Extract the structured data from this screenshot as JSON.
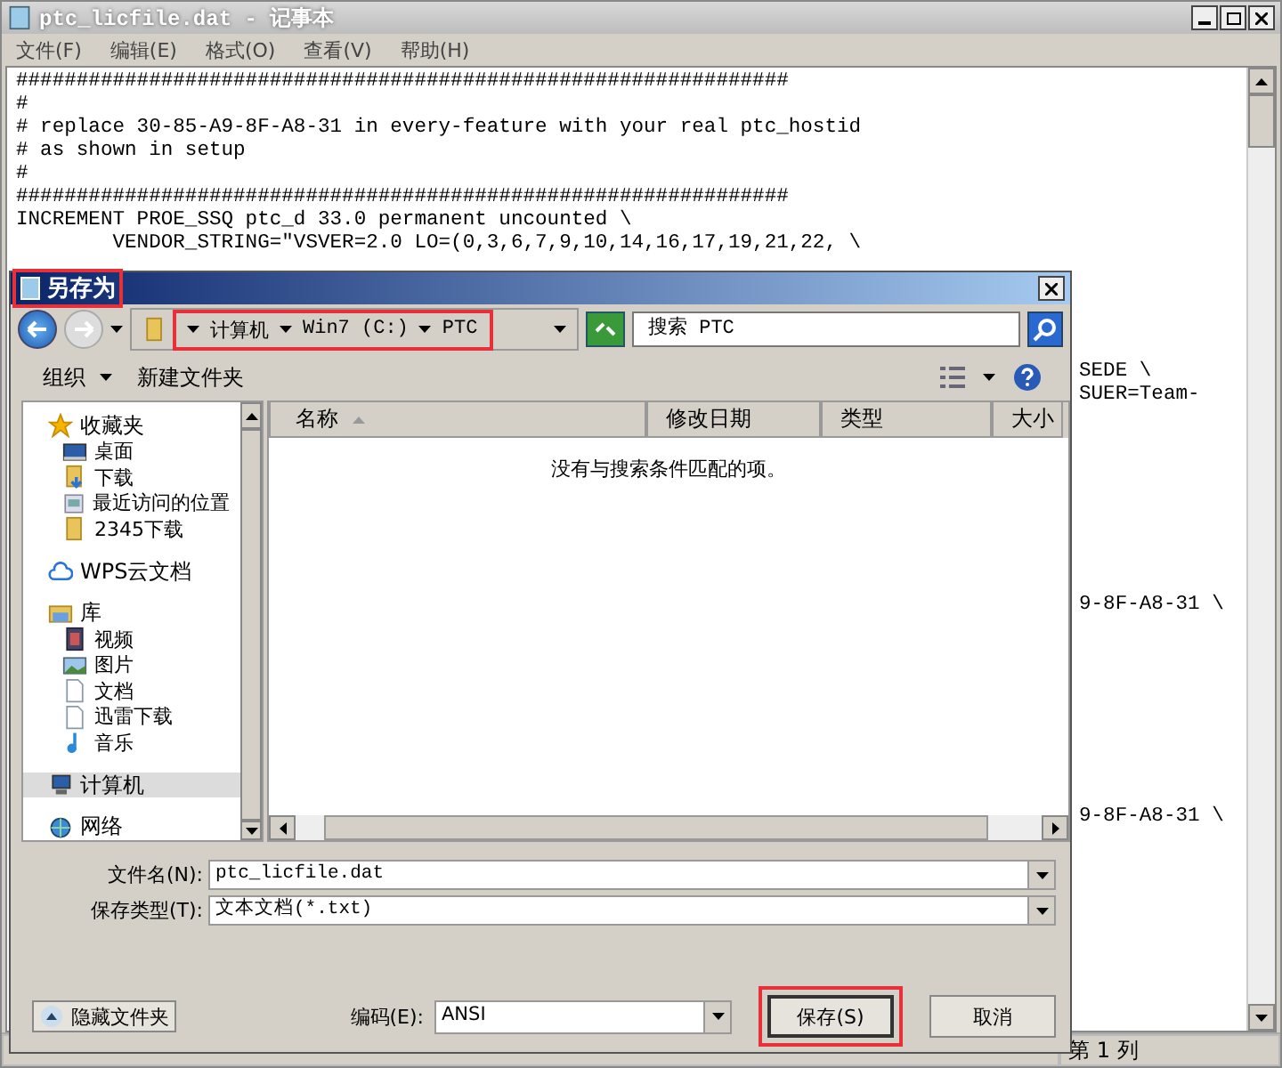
{
  "window": {
    "title": "ptc_licfile.dat - 记事本"
  },
  "menu": [
    "文件(F)",
    "编辑(E)",
    "格式(O)",
    "查看(V)",
    "帮助(H)"
  ],
  "editor": {
    "lines": [
      "################################################################",
      "#",
      "# replace 30-85-A9-8F-A8-31 in every-feature with your real ptc_hostid",
      "# as shown in setup",
      "#",
      "################################################################",
      "INCREMENT PROE_SSQ ptc_d 33.0 permanent uncounted \\",
      "        VENDOR_STRING=\"VSVER=2.0 LO=(0,3,6,7,9,10,14,16,17,19,21,22, \\"
    ],
    "fragments": [
      "SEDE \\",
      "SUER=Team-",
      "9-8F-A8-31 \\",
      "9-8F-A8-31 \\"
    ]
  },
  "status_bar": {
    "position": "第 1 列"
  },
  "dialog": {
    "title": "另存为",
    "title_highlighted": true,
    "breadcrumb": {
      "highlighted": true,
      "parts": [
        "计算机",
        "Win7 (C:)",
        "PTC"
      ]
    },
    "search": {
      "placeholder": "搜索 PTC"
    },
    "toolbar": {
      "organize": "组织",
      "new_folder": "新建文件夹"
    },
    "nav": [
      {
        "label": "收藏夹",
        "kind": "star",
        "selected": false,
        "children": [
          {
            "label": "桌面",
            "kind": "desktop",
            "selected": false
          },
          {
            "label": "下载",
            "kind": "download",
            "selected": false
          },
          {
            "label": "最近访问的位置",
            "kind": "recent",
            "selected": false
          },
          {
            "label": "2345下载",
            "kind": "folder",
            "selected": false
          }
        ]
      },
      {
        "label": "WPS云文档",
        "kind": "cloud",
        "selected": false
      },
      {
        "label": "库",
        "kind": "library",
        "selected": false,
        "children": [
          {
            "label": "视频",
            "kind": "video",
            "selected": false
          },
          {
            "label": "图片",
            "kind": "picture",
            "selected": false
          },
          {
            "label": "文档",
            "kind": "document",
            "selected": false
          },
          {
            "label": "迅雷下载",
            "kind": "document",
            "selected": false
          },
          {
            "label": "音乐",
            "kind": "music",
            "selected": false
          }
        ]
      },
      {
        "label": "计算机",
        "kind": "computer",
        "selected": true
      },
      {
        "label": "网络",
        "kind": "network",
        "selected": false
      }
    ],
    "columns": [
      "名称",
      "修改日期",
      "类型",
      "大小"
    ],
    "empty_message": "没有与搜索条件匹配的项。",
    "file_name": {
      "label": "文件名(N):",
      "value": "ptc_licfile.dat"
    },
    "file_type": {
      "label": "保存类型(T):",
      "value": "文本文档(*.txt)"
    },
    "hide_folders": "隐藏文件夹",
    "encoding": {
      "label": "编码(E):",
      "value": "ANSI"
    },
    "buttons": [
      {
        "label": "保存(S)",
        "highlighted": true
      },
      {
        "label": "取消",
        "highlighted": false
      }
    ]
  }
}
